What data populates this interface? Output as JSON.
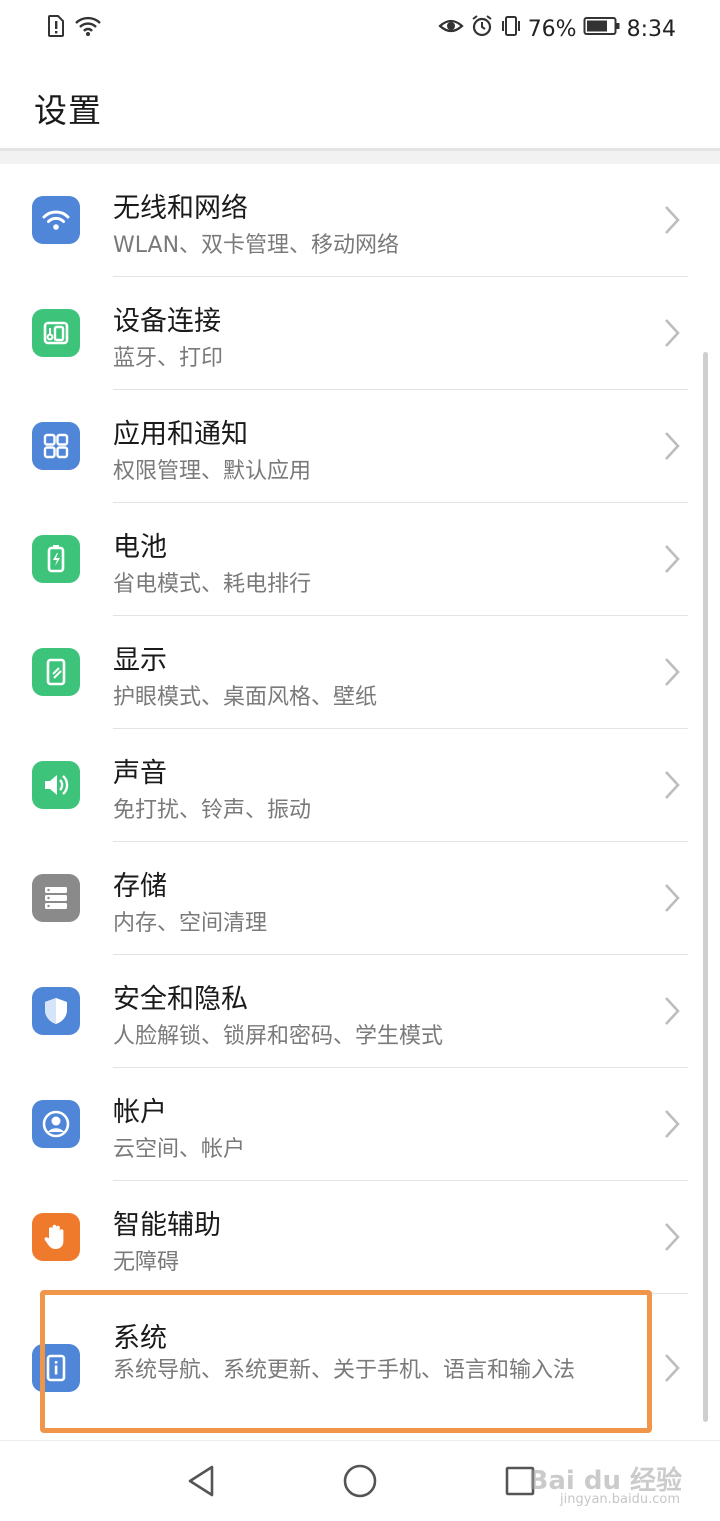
{
  "status_bar": {
    "battery_percent": "76%",
    "time": "8:34",
    "icons": [
      "sim-alert-icon",
      "wifi-status-icon",
      "eye-comfort-icon",
      "alarm-icon",
      "vibrate-icon",
      "battery-icon"
    ]
  },
  "header": {
    "title": "设置"
  },
  "settings": [
    {
      "title": "无线和网络",
      "subtitle": "WLAN、双卡管理、移动网络",
      "icon": "wifi-icon",
      "color": "#4f86d8"
    },
    {
      "title": "设备连接",
      "subtitle": "蓝牙、打印",
      "icon": "device-connect-icon",
      "color": "#3dc47a"
    },
    {
      "title": "应用和通知",
      "subtitle": "权限管理、默认应用",
      "icon": "apps-grid-icon",
      "color": "#4f86d8"
    },
    {
      "title": "电池",
      "subtitle": "省电模式、耗电排行",
      "icon": "battery-settings-icon",
      "color": "#3dc47a"
    },
    {
      "title": "显示",
      "subtitle": "护眼模式、桌面风格、壁纸",
      "icon": "display-icon",
      "color": "#3dc47a"
    },
    {
      "title": "声音",
      "subtitle": "免打扰、铃声、振动",
      "icon": "speaker-icon",
      "color": "#3dc47a"
    },
    {
      "title": "存储",
      "subtitle": "内存、空间清理",
      "icon": "storage-icon",
      "color": "#8a8a8a"
    },
    {
      "title": "安全和隐私",
      "subtitle": "人脸解锁、锁屏和密码、学生模式",
      "icon": "shield-icon",
      "color": "#4f86d8"
    },
    {
      "title": "帐户",
      "subtitle": "云空间、帐户",
      "icon": "account-icon",
      "color": "#4f86d8"
    },
    {
      "title": "智能辅助",
      "subtitle": "无障碍",
      "icon": "hand-icon",
      "color": "#f07a2b"
    },
    {
      "title": "系统",
      "subtitle": "系统导航、系统更新、关于手机、语言和输入法",
      "icon": "system-info-icon",
      "color": "#4f86d8"
    }
  ],
  "highlight_color": "#f0964a",
  "watermark": {
    "text": "Bai du 经验",
    "sub": "jingyan.baidu.com"
  }
}
